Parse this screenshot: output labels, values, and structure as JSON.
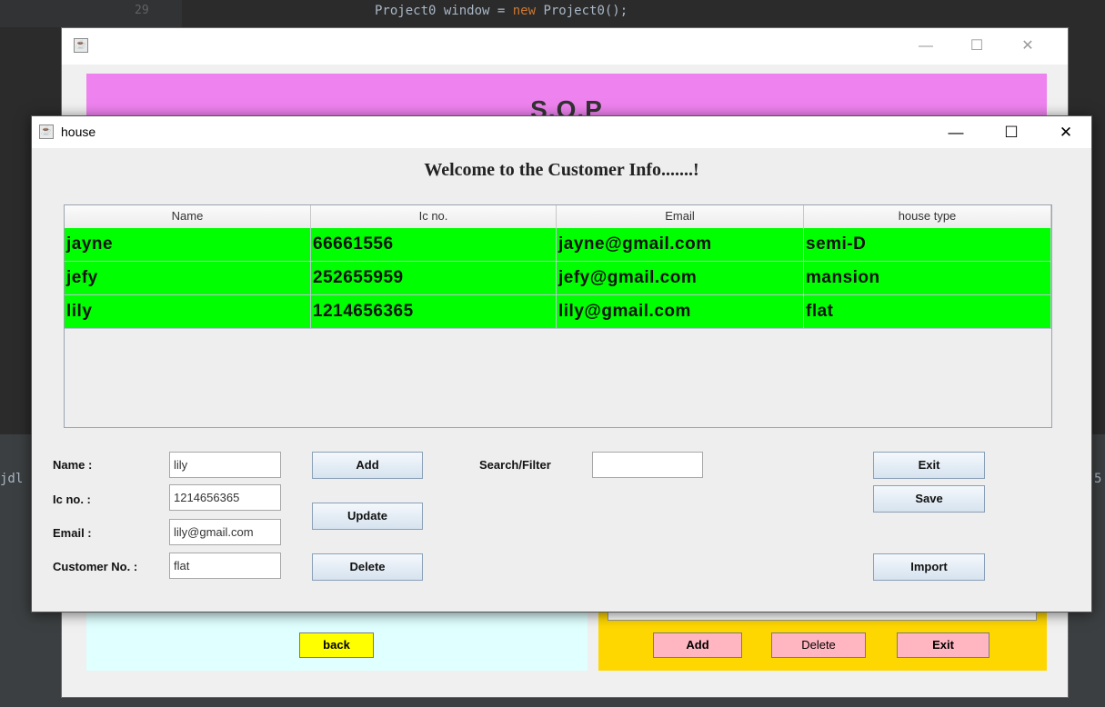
{
  "ide": {
    "line_number": "29",
    "code_prefix": "Project0 window = ",
    "code_keyword": "new",
    "code_suffix": " Project0();",
    "left_text": "jdl",
    "right_text": "5"
  },
  "back_window": {
    "banner_title": "S.O.P",
    "minimize_glyph": "—",
    "maximize_glyph": "☐",
    "close_glyph": "✕",
    "back_button": "back",
    "add_button": "Add",
    "delete_button": "Delete",
    "exit_button": "Exit"
  },
  "house_window": {
    "title": "house",
    "minimize_glyph": "—",
    "maximize_glyph": "☐",
    "close_glyph": "✕",
    "heading": "Welcome to the Customer Info.......!",
    "table": {
      "columns": [
        "Name",
        "Ic no.",
        "Email",
        "house type"
      ],
      "rows": [
        [
          "jayne",
          "66661556",
          "jayne@gmail.com",
          "semi-D"
        ],
        [
          "jefy",
          "252655959",
          "jefy@gmail.com",
          "mansion"
        ],
        [
          "lily",
          "1214656365",
          "lily@gmail.com",
          "flat"
        ]
      ],
      "row_color": "#00ff00"
    },
    "form": {
      "name_label": "Name :",
      "name_value": "lily",
      "ic_label": "Ic no. :",
      "ic_value": "1214656365",
      "email_label": "Email :",
      "email_value": "lily@gmail.com",
      "customer_label": "Customer No. :",
      "customer_value": "flat",
      "search_label": "Search/Filter",
      "search_value": ""
    },
    "buttons": {
      "add": "Add",
      "update": "Update",
      "delete": "Delete",
      "exit": "Exit",
      "save": "Save",
      "import": "Import"
    }
  },
  "colors": {
    "banner_pink": "#ee82ee",
    "panel_cyan": "#e0ffff",
    "panel_yellow": "#ffd700",
    "back_button_yellow": "#ffff00",
    "action_button_pink": "#ffb6c1"
  },
  "icons": [
    "java-app-icon",
    "minimize-icon",
    "maximize-icon",
    "close-icon"
  ]
}
